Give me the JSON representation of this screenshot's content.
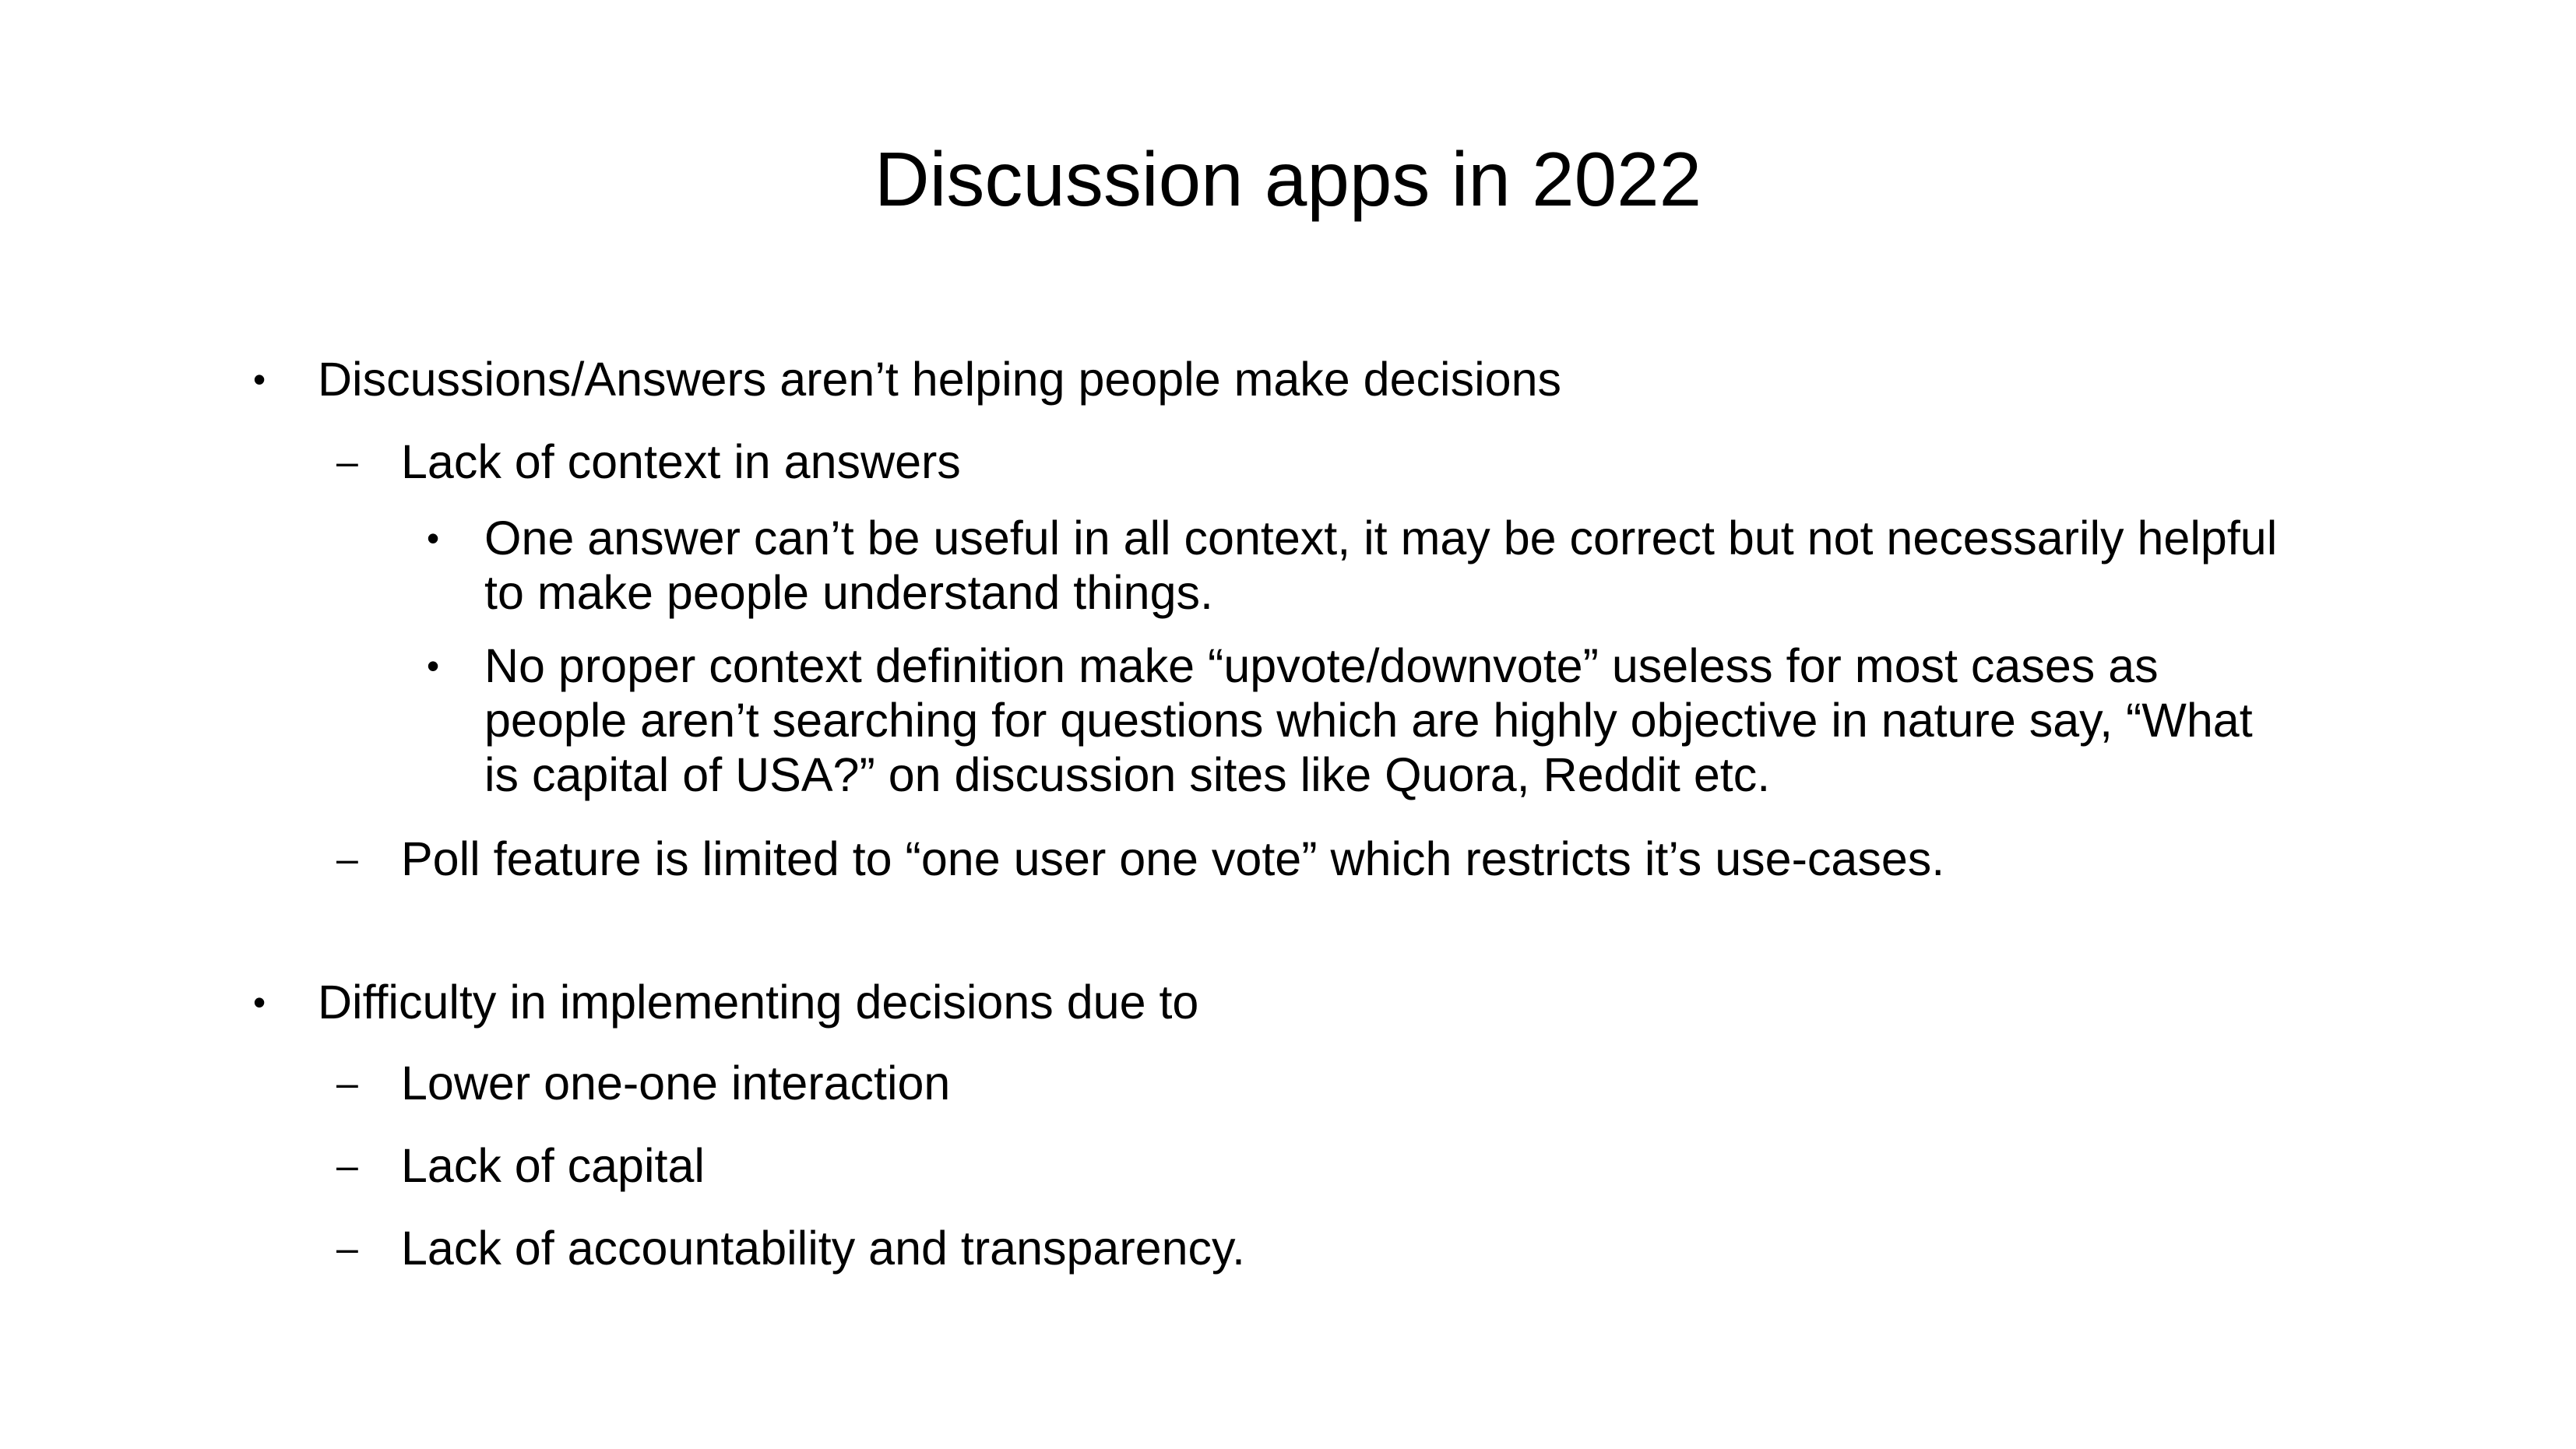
{
  "slide": {
    "title": "Discussion apps in 2022",
    "bullet_symbol": "•",
    "dash_symbol": "–",
    "items": [
      {
        "text": "Discussions/Answers aren’t helping people make decisions"
      },
      {
        "text": "Lack of context in answers"
      },
      {
        "lines": [
          "One answer can’t be useful in all context, it may be correct but not necessarily helpful",
          "to make people understand things."
        ]
      },
      {
        "lines": [
          "No proper context definition make “upvote/downvote” useless for most cases as",
          "people aren’t searching for questions which are highly objective in nature say, “What",
          "is capital of USA?” on discussion sites like Quora, Reddit etc."
        ]
      },
      {
        "text": "Poll feature is limited to “one user one vote” which restricts it’s use-cases."
      },
      {
        "text": "Difficulty in implementing decisions due to"
      },
      {
        "text": "Lower one-one interaction"
      },
      {
        "text": "Lack of capital"
      },
      {
        "text": "Lack of accountability and transparency."
      }
    ]
  }
}
